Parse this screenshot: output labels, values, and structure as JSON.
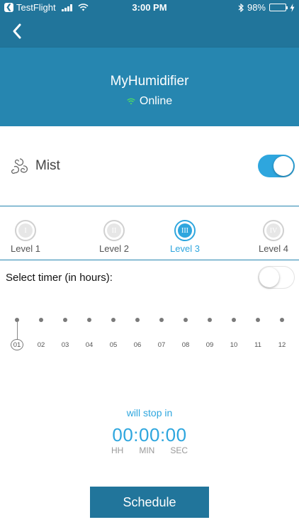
{
  "status_bar": {
    "carrier": "TestFlight",
    "time": "3:00 PM",
    "battery_percent": "98%",
    "battery_level": 0.98,
    "icons": [
      "back-to-app-icon",
      "signal-icon",
      "wifi-icon",
      "bluetooth-icon",
      "battery-icon",
      "charging-icon"
    ]
  },
  "nav": {
    "back_icon": "chevron-left-icon"
  },
  "device": {
    "name": "MyHumidifier",
    "status": "Online",
    "status_icon": "wifi-icon"
  },
  "mist": {
    "label": "Mist",
    "icon": "mist-swirl-icon",
    "enabled": true
  },
  "levels": [
    {
      "numeral": "I",
      "label": "Level 1",
      "active": false
    },
    {
      "numeral": "II",
      "label": "Level 2",
      "active": false
    },
    {
      "numeral": "III",
      "label": "Level 3",
      "active": true
    },
    {
      "numeral": "IV",
      "label": "Level 4",
      "active": false
    }
  ],
  "timer": {
    "label": "Select timer (in hours):",
    "enabled": false,
    "hours": [
      "01",
      "02",
      "03",
      "04",
      "05",
      "06",
      "07",
      "08",
      "09",
      "10",
      "11",
      "12"
    ],
    "selected": "01"
  },
  "countdown": {
    "caption": "will stop in",
    "value": "00:00:00",
    "units": [
      "HH",
      "MIN",
      "SEC"
    ]
  },
  "schedule_label": "Schedule",
  "colors": {
    "header_dark": "#21759b",
    "header": "#2686b0",
    "accent": "#2ea6de",
    "online": "#4cd964"
  }
}
